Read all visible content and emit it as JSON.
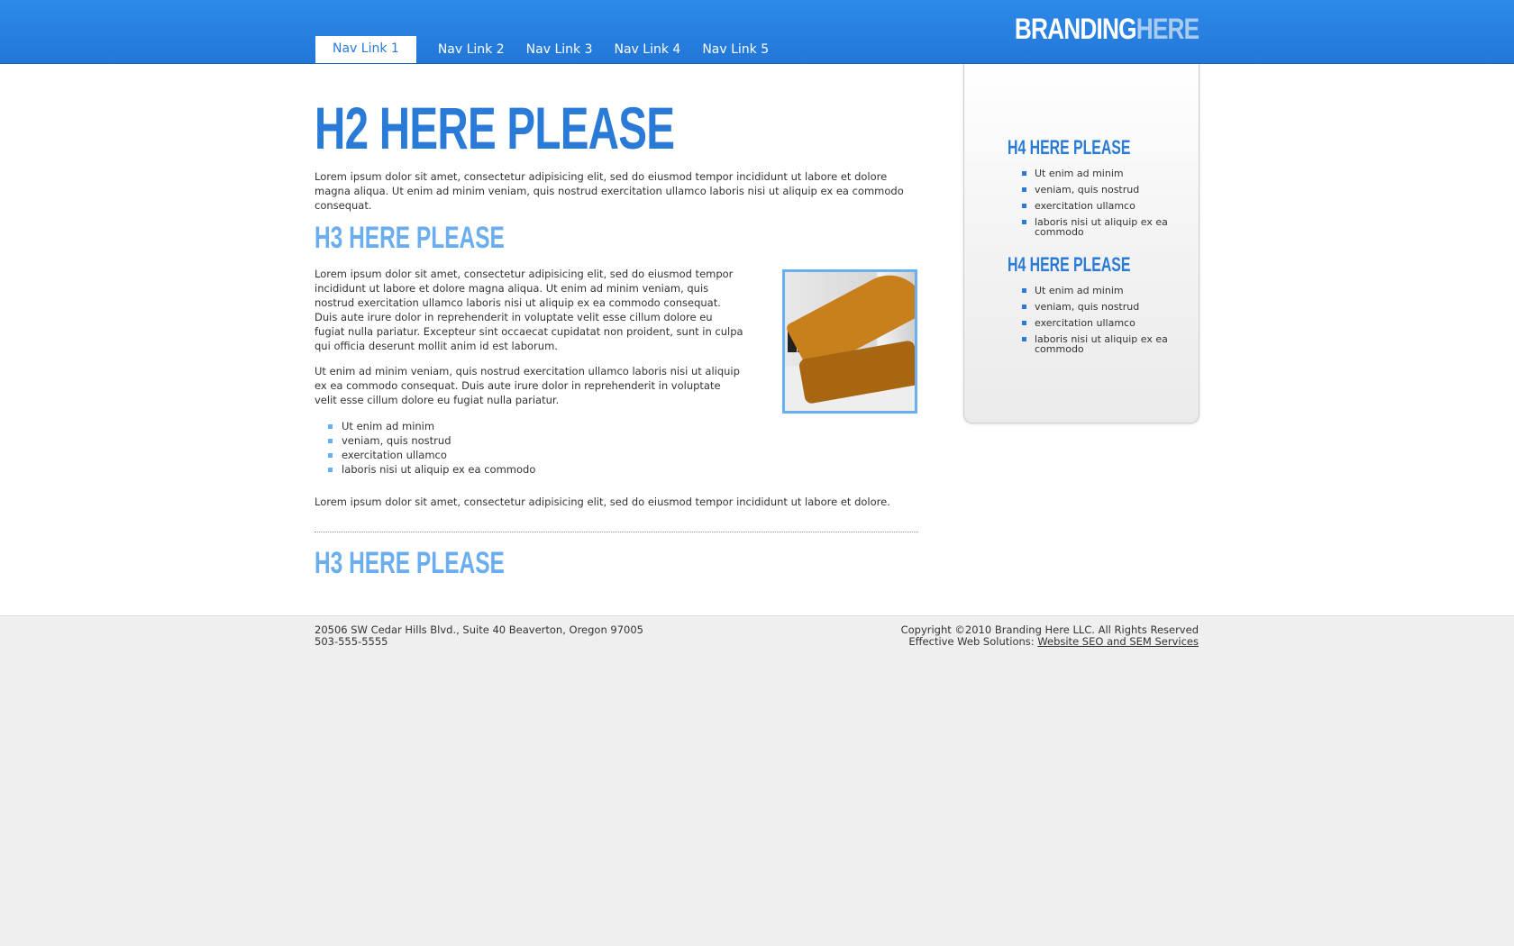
{
  "header": {
    "nav": [
      "Nav Link 1",
      "Nav Link 2",
      "Nav Link 3",
      "Nav Link 4",
      "Nav Link 5"
    ],
    "brand_part1": "BRANDING",
    "brand_part2": "HERE"
  },
  "main": {
    "h2": "H2 HERE PLEASE",
    "intro": "Lorem ipsum dolor sit amet, consectetur adipisicing elit, sed do eiusmod tempor incididunt ut labore et dolore magna aliqua. Ut enim ad minim veniam, quis nostrud exercitation ullamco laboris nisi ut aliquip ex ea commodo consequat.",
    "h3_first": "H3 HERE PLEASE",
    "para1": "Lorem ipsum dolor sit amet, consectetur adipisicing elit, sed do eiusmod tempor incididunt ut labore et dolore magna aliqua. Ut enim ad minim veniam, quis nostrud exercitation ullamco laboris nisi ut aliquip ex ea commodo consequat. Duis aute irure dolor in reprehenderit in voluptate velit esse cillum dolore eu fugiat nulla pariatur. Excepteur sint occaecat cupidatat non proident, sunt in culpa qui officia deserunt mollit anim id est laborum.",
    "para2": "Ut enim ad minim veniam, quis nostrud exercitation ullamco laboris nisi ut aliquip ex ea commodo consequat. Duis aute irure dolor in reprehenderit in voluptate velit esse cillum dolore eu fugiat nulla pariatur.",
    "list": [
      "Ut enim ad minim",
      "veniam, quis nostrud",
      "exercitation ullamco",
      "laboris nisi ut aliquip ex ea commodo"
    ],
    "para3": "Lorem ipsum dolor sit amet, consectetur adipisicing elit, sed do eiusmod tempor incididunt ut labore et dolore.",
    "h3_second": "H3 HERE PLEASE"
  },
  "sidebar": {
    "h4_first": "H4 HERE PLEASE",
    "list1": [
      "Ut enim ad minim",
      "veniam, quis nostrud",
      "exercitation ullamco",
      "laboris nisi ut aliquip ex ea commodo"
    ],
    "h4_second": "H4 HERE PLEASE",
    "list2": [
      "Ut enim ad minim",
      "veniam, quis nostrud",
      "exercitation ullamco",
      "laboris nisi ut aliquip ex ea commodo"
    ]
  },
  "footer": {
    "address": "20506 SW Cedar Hills Blvd., Suite 40 Beaverton, Oregon 97005",
    "phone": "503-555-5555",
    "copyright": "Copyright ©2010 Branding Here LLC. All Rights Reserved",
    "solutions_prefix": "Effective Web Solutions: ",
    "solutions_link": "Website SEO and SEM Services"
  },
  "colors": {
    "header_blue": "#2e8ae8",
    "heading_blue": "#2a7ad8",
    "light_blue": "#6aaef0",
    "footer_gray": "#efefef"
  }
}
